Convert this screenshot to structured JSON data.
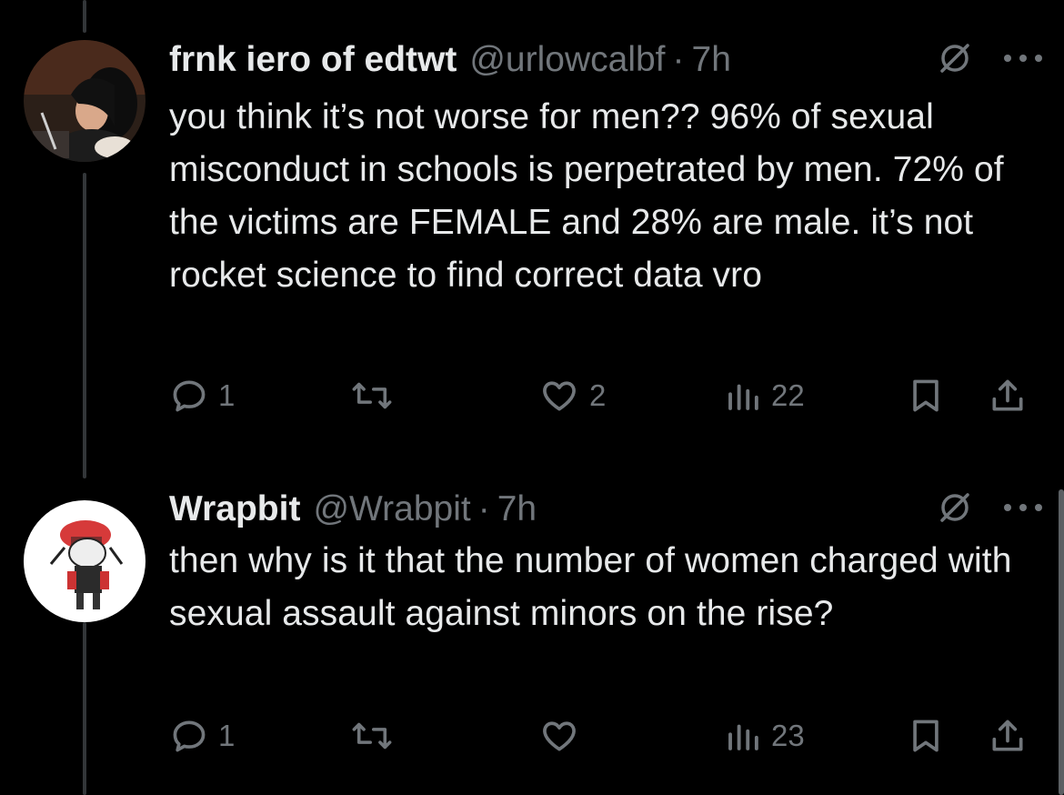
{
  "tweets": [
    {
      "name": "frnk iero of edtwt",
      "handle": "@urlowcalbf",
      "time": "7h",
      "text": "you think it’s not worse for men?? 96% of sexual misconduct in schools is perpetrated by men. 72% of the victims are FEMALE and 28% are male. it’s not rocket science to find correct data vro",
      "replies": "1",
      "retweets": "",
      "likes": "2",
      "views": "22"
    },
    {
      "name": "Wrapbit",
      "handle": "@Wrabpit",
      "time": "7h",
      "text": "then why is it that the number of women charged with sexual assault against minors on the rise?",
      "replies": "1",
      "retweets": "",
      "likes": "",
      "views": "23"
    }
  ],
  "separator": "·",
  "icons": {
    "reply": "reply-icon",
    "retweet": "retweet-icon",
    "like": "heart-icon",
    "views": "views-icon",
    "bookmark": "bookmark-icon",
    "share": "share-icon",
    "grok": "grok-icon",
    "more": "more-icon"
  },
  "colors": {
    "background": "#000000",
    "text": "#e7e9ea",
    "muted": "#71767b",
    "thread_line": "#333639"
  }
}
